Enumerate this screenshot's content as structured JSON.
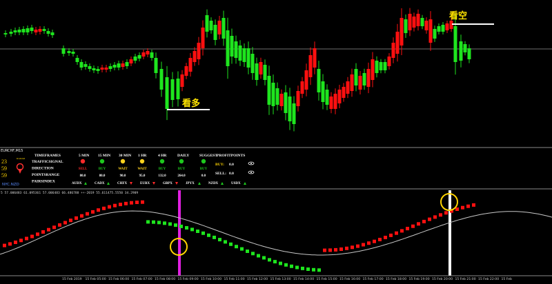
{
  "annotations": {
    "buy_label": "看多",
    "sell_label": "看空"
  },
  "price_chart": {
    "candles": [
      [
        8,
        48,
        2,
        "g"
      ],
      [
        16,
        46,
        3,
        "g"
      ],
      [
        22,
        44,
        3,
        "g"
      ],
      [
        28,
        43,
        4,
        "g"
      ],
      [
        34,
        42,
        5,
        "g"
      ],
      [
        40,
        41,
        6,
        "g"
      ],
      [
        46,
        40,
        5,
        "g"
      ],
      [
        52,
        43,
        4,
        "r"
      ],
      [
        58,
        42,
        4,
        "r"
      ],
      [
        64,
        42,
        3,
        "g"
      ],
      [
        70,
        45,
        4,
        "g"
      ],
      [
        76,
        47,
        4,
        "g"
      ],
      [
        92,
        70,
        8,
        "g"
      ],
      [
        100,
        74,
        3,
        "g"
      ],
      [
        106,
        75,
        3,
        "g"
      ],
      [
        112,
        84,
        6,
        "g"
      ],
      [
        118,
        90,
        8,
        "g"
      ],
      [
        124,
        93,
        4,
        "g"
      ],
      [
        130,
        96,
        4,
        "g"
      ],
      [
        136,
        99,
        3,
        "g"
      ],
      [
        142,
        100,
        3,
        "g"
      ],
      [
        148,
        98,
        3,
        "r"
      ],
      [
        154,
        98,
        3,
        "r"
      ],
      [
        160,
        96,
        4,
        "g"
      ],
      [
        166,
        94,
        4,
        "g"
      ],
      [
        172,
        92,
        6,
        "g"
      ],
      [
        178,
        92,
        5,
        "r"
      ],
      [
        184,
        90,
        6,
        "g"
      ],
      [
        190,
        86,
        6,
        "r"
      ],
      [
        196,
        82,
        6,
        "g"
      ],
      [
        202,
        80,
        5,
        "g"
      ],
      [
        208,
        76,
        6,
        "r"
      ],
      [
        214,
        74,
        5,
        "r"
      ],
      [
        220,
        76,
        8,
        "g"
      ],
      [
        226,
        84,
        22,
        "g"
      ],
      [
        234,
        100,
        30,
        "g"
      ],
      [
        242,
        112,
        46,
        "g"
      ],
      [
        250,
        115,
        30,
        "g"
      ],
      [
        258,
        114,
        30,
        "g"
      ],
      [
        264,
        108,
        18,
        "r"
      ],
      [
        270,
        96,
        14,
        "r"
      ],
      [
        276,
        84,
        20,
        "r"
      ],
      [
        282,
        74,
        16,
        "r"
      ],
      [
        288,
        62,
        24,
        "r"
      ],
      [
        294,
        40,
        30,
        "r"
      ],
      [
        300,
        22,
        24,
        "g"
      ],
      [
        306,
        30,
        14,
        "g"
      ],
      [
        312,
        36,
        22,
        "g"
      ],
      [
        318,
        30,
        20,
        "r"
      ],
      [
        324,
        26,
        30,
        "g"
      ],
      [
        330,
        44,
        52,
        "g"
      ],
      [
        336,
        52,
        30,
        "g"
      ],
      [
        342,
        60,
        24,
        "g"
      ],
      [
        348,
        66,
        22,
        "g"
      ],
      [
        354,
        70,
        20,
        "g"
      ],
      [
        360,
        70,
        28,
        "g"
      ],
      [
        366,
        78,
        28,
        "g"
      ],
      [
        372,
        92,
        24,
        "g"
      ],
      [
        378,
        90,
        18,
        "r"
      ],
      [
        384,
        94,
        22,
        "g"
      ],
      [
        390,
        110,
        42,
        "g"
      ],
      [
        396,
        120,
        34,
        "g"
      ],
      [
        402,
        128,
        24,
        "g"
      ],
      [
        408,
        136,
        18,
        "r"
      ],
      [
        414,
        134,
        30,
        "g"
      ],
      [
        420,
        140,
        36,
        "g"
      ],
      [
        426,
        150,
        30,
        "g"
      ],
      [
        432,
        132,
        22,
        "r"
      ],
      [
        438,
        118,
        18,
        "r"
      ],
      [
        444,
        102,
        28,
        "r"
      ],
      [
        450,
        80,
        32,
        "r"
      ],
      [
        456,
        70,
        28,
        "r"
      ],
      [
        462,
        100,
        34,
        "g"
      ],
      [
        468,
        118,
        30,
        "g"
      ],
      [
        474,
        130,
        22,
        "g"
      ],
      [
        480,
        140,
        18,
        "r"
      ],
      [
        486,
        136,
        22,
        "r"
      ],
      [
        492,
        130,
        20,
        "r"
      ],
      [
        498,
        126,
        16,
        "r"
      ],
      [
        504,
        118,
        18,
        "r"
      ],
      [
        510,
        108,
        24,
        "r"
      ],
      [
        516,
        100,
        24,
        "g"
      ],
      [
        522,
        110,
        20,
        "r"
      ],
      [
        528,
        106,
        18,
        "g"
      ],
      [
        534,
        100,
        26,
        "r"
      ],
      [
        540,
        86,
        30,
        "r"
      ],
      [
        546,
        88,
        18,
        "g"
      ],
      [
        552,
        90,
        12,
        "g"
      ],
      [
        558,
        90,
        12,
        "g"
      ],
      [
        564,
        82,
        14,
        "r"
      ],
      [
        570,
        62,
        22,
        "r"
      ],
      [
        576,
        46,
        32,
        "r"
      ],
      [
        582,
        26,
        40,
        "r"
      ],
      [
        588,
        28,
        20,
        "g"
      ],
      [
        594,
        20,
        24,
        "r"
      ],
      [
        600,
        24,
        16,
        "r"
      ],
      [
        606,
        20,
        18,
        "r"
      ],
      [
        612,
        26,
        12,
        "g"
      ],
      [
        618,
        30,
        14,
        "r"
      ],
      [
        624,
        28,
        34,
        "r"
      ],
      [
        630,
        42,
        14,
        "g"
      ],
      [
        636,
        38,
        8,
        "g"
      ],
      [
        642,
        36,
        10,
        "g"
      ],
      [
        648,
        34,
        10,
        "r"
      ],
      [
        654,
        30,
        12,
        "r"
      ],
      [
        660,
        38,
        52,
        "g"
      ],
      [
        668,
        60,
        28,
        "g"
      ],
      [
        674,
        64,
        12,
        "g"
      ],
      [
        680,
        70,
        16,
        "g"
      ]
    ]
  },
  "dashboard": {
    "symbol": "EURCHF,M15",
    "left_values": [
      "23",
      "59",
      "59"
    ],
    "radar_label": "RADAR",
    "pair_label": "NYC.NZD",
    "header": [
      "TIMEFRAMES",
      "5 MIN",
      "15 MIN",
      "30 MIN",
      "1 HR",
      "4 HR",
      "DAILY",
      "SUGGEST",
      "PROFITPOINTS"
    ],
    "row_labels": [
      "TRAFFICSIGNAL",
      "DIRECTION",
      "POINTSRANGE",
      "PAIRSINDEX"
    ],
    "directions": [
      "SELL",
      "BUY",
      "WAIT",
      "WAIT",
      "BUY",
      "BUY",
      "BUY"
    ],
    "direction_colors": [
      "#ff2a2a",
      "#1ec81e",
      "#ffd21e",
      "#ffd21e",
      "#1ec81e",
      "#1ec81e",
      "#1ec81e"
    ],
    "points": [
      "80.0",
      "80.0",
      "90.0",
      "95.0",
      "132.0",
      "264.0",
      "0.0"
    ],
    "profit": {
      "buy_label": "BUY:",
      "buy_value": "0.0",
      "sell_label": "SELL:",
      "sell_value": "0.0"
    },
    "pairs": [
      "AUDX",
      "CADX",
      "CHFX",
      "EURX",
      "GBPX",
      "JPYX",
      "NZDX",
      "USDX"
    ]
  },
  "indicator": {
    "info": "5 57.006483 61.095361 57.006483 66.486788 ++-2019 55.611475.5550 34.2909"
  },
  "time_axis": {
    "labels": [
      "15 Feb 2019",
      "15 Feb 05:00",
      "15 Feb 06:00",
      "15 Feb 07:00",
      "15 Feb 08:00",
      "15 Feb 09:00",
      "15 Feb 10:00",
      "15 Feb 11:00",
      "15 Feb 12:00",
      "15 Feb 13:00",
      "15 Feb 14:00",
      "15 Feb 15:00",
      "15 Feb 16:00",
      "15 Feb 17:00",
      "15 Feb 18:00",
      "15 Feb 19:00",
      "15 Feb 20:00",
      "15 Feb 21:00",
      "15 Feb 22:00",
      "15 Feb"
    ]
  },
  "colors": {
    "bull": "#1ee51e",
    "bear": "#ff1010",
    "vline_magenta": "#e020e0",
    "vline_white": "#ffffff",
    "circle": "#ffd400",
    "curve": "#c8c8c8"
  }
}
